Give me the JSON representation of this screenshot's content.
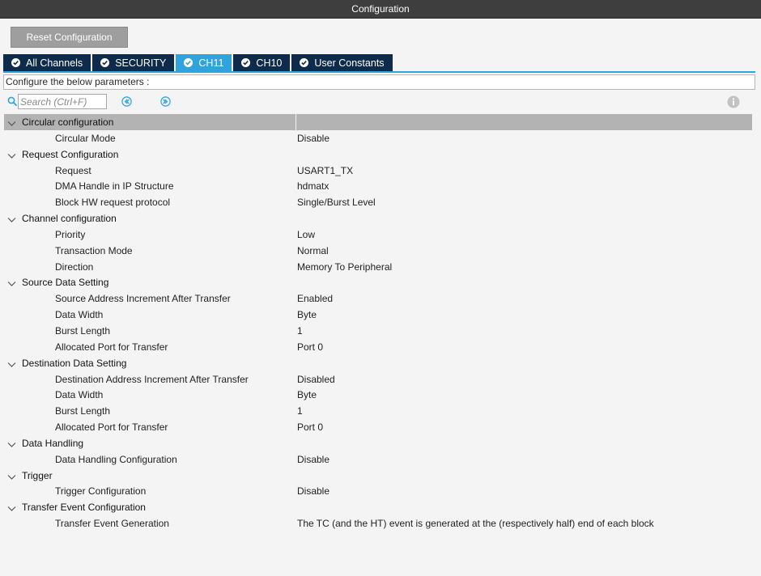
{
  "window": {
    "title": "Configuration"
  },
  "toolbar": {
    "reset_label": "Reset Configuration"
  },
  "tabs": [
    {
      "label": "All Channels",
      "active": false
    },
    {
      "label": "SECURITY",
      "active": false
    },
    {
      "label": "CH11",
      "active": true
    },
    {
      "label": "CH10",
      "active": false
    },
    {
      "label": "User Constants",
      "active": false
    }
  ],
  "description": "Configure the below parameters :",
  "search": {
    "placeholder": "Search (Ctrl+F)",
    "value": ""
  },
  "icons": {
    "search": "search-icon",
    "prev": "arrow-left-circle-icon",
    "next": "arrow-right-circle-icon",
    "info": "info-icon",
    "expand": "chevron-down-icon",
    "tab_check": "check-circle-icon"
  },
  "colors": {
    "titlebar": "#3e3e3e",
    "tab_bg": "#0f2b4c",
    "tab_active": "#2ea3dd",
    "selected_row": "#b3b3b3",
    "nav_icon": "#2ea3dd"
  },
  "groups": [
    {
      "label": "Circular configuration",
      "selected": true,
      "params": [
        {
          "label": "Circular Mode",
          "value": "Disable"
        }
      ]
    },
    {
      "label": "Request Configuration",
      "params": [
        {
          "label": "Request",
          "value": "USART1_TX"
        },
        {
          "label": "DMA Handle in IP Structure",
          "value": "hdmatx"
        },
        {
          "label": "Block HW request protocol",
          "value": "Single/Burst Level"
        }
      ]
    },
    {
      "label": "Channel configuration",
      "params": [
        {
          "label": "Priority",
          "value": "Low"
        },
        {
          "label": "Transaction Mode",
          "value": "Normal"
        },
        {
          "label": "Direction",
          "value": "Memory To Peripheral"
        }
      ]
    },
    {
      "label": "Source Data Setting",
      "params": [
        {
          "label": "Source Address Increment After Transfer",
          "value": "Enabled"
        },
        {
          "label": "Data Width",
          "value": "Byte"
        },
        {
          "label": "Burst Length",
          "value": "1"
        },
        {
          "label": "Allocated Port for Transfer",
          "value": "Port 0"
        }
      ]
    },
    {
      "label": "Destination Data Setting",
      "params": [
        {
          "label": "Destination Address Increment After Transfer",
          "value": "Disabled"
        },
        {
          "label": "Data Width",
          "value": "Byte"
        },
        {
          "label": "Burst Length",
          "value": "1"
        },
        {
          "label": "Allocated Port for Transfer",
          "value": "Port 0"
        }
      ]
    },
    {
      "label": "Data Handling",
      "params": [
        {
          "label": "Data Handling Configuration",
          "value": "Disable"
        }
      ]
    },
    {
      "label": "Trigger",
      "params": [
        {
          "label": "Trigger Configuration",
          "value": "Disable"
        }
      ]
    },
    {
      "label": "Transfer Event Configuration",
      "params": [
        {
          "label": "Transfer Event Generation",
          "value": "The TC (and the HT) event is generated at the (respectively half) end of each block"
        }
      ]
    }
  ]
}
